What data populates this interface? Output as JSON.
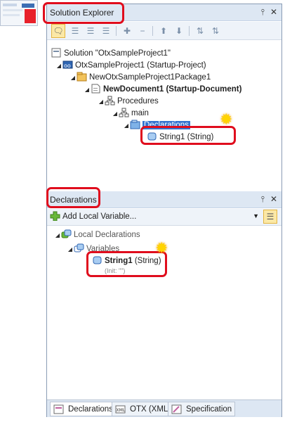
{
  "solution_explorer": {
    "title": "Solution Explorer",
    "pin_icon": "pin-icon",
    "close_icon": "close-icon",
    "tree": {
      "solution": "Solution \"OtxSampleProject1\"",
      "project": "OtxSampleProject1 (Startup-Project)",
      "package": "NewOtxSampleProject1Package1",
      "document": "NewDocument1 (Startup-Document)",
      "procedures": "Procedures",
      "main": "main",
      "declarations": "Declarations",
      "string_item": "String1 (String)"
    }
  },
  "declarations_panel": {
    "title": "Declarations",
    "add_local_variable": "Add Local Variable...",
    "tree": {
      "local_declarations": "Local Declarations",
      "variables": "Variables",
      "string_name": "String1",
      "string_type": "(String)",
      "string_init": "(Init: \"\")"
    }
  },
  "tabs": [
    {
      "label": "Declarations"
    },
    {
      "label": "OTX (XML)"
    },
    {
      "label": "Specification"
    }
  ],
  "colors": {
    "highlight": "#e00d1d",
    "selection": "#3374d0",
    "header": "#dde7f3",
    "star": "#ffd400"
  }
}
